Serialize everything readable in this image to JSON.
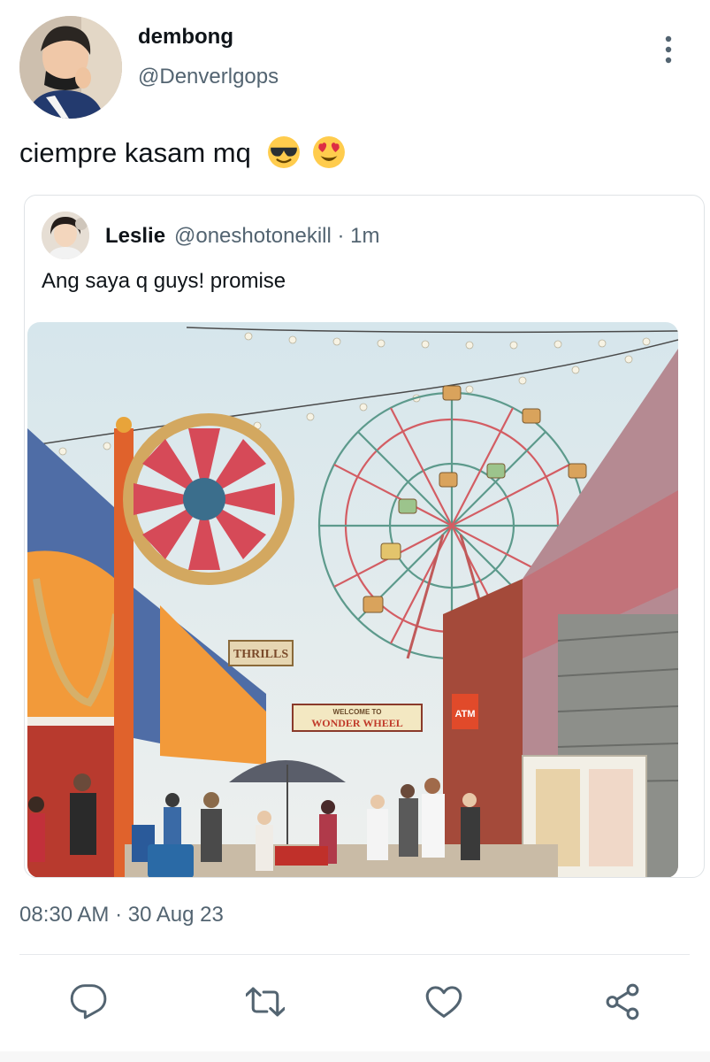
{
  "author": {
    "name": "dembong",
    "handle": "@Denverlgops",
    "avatar_icon": "user-avatar-photo"
  },
  "tweet": {
    "text": "ciempre kasam mq",
    "emojis": [
      "smiling-face-with-sunglasses",
      "smiling-face-with-heart-eyes"
    ]
  },
  "quoted_tweet": {
    "name": "Leslie",
    "handle_time": "@oneshotonekill · 1m",
    "text": "Ang saya q guys! promise",
    "media": {
      "description_icon": "amusement-park-photo",
      "sign_welcome": "WELCOME TO",
      "sign_title": "WONDER WHEEL",
      "sign_thrills": "THRILLS",
      "sign_atm": "ATM"
    }
  },
  "timestamp": "08:30 AM · 30 Aug 23",
  "actions": {
    "reply_icon": "reply-icon",
    "retweet_icon": "retweet-icon",
    "like_icon": "heart-icon",
    "share_icon": "share-icon"
  },
  "colors": {
    "text_primary": "#0f1419",
    "text_secondary": "#536471",
    "border": "#dfe3e6"
  }
}
